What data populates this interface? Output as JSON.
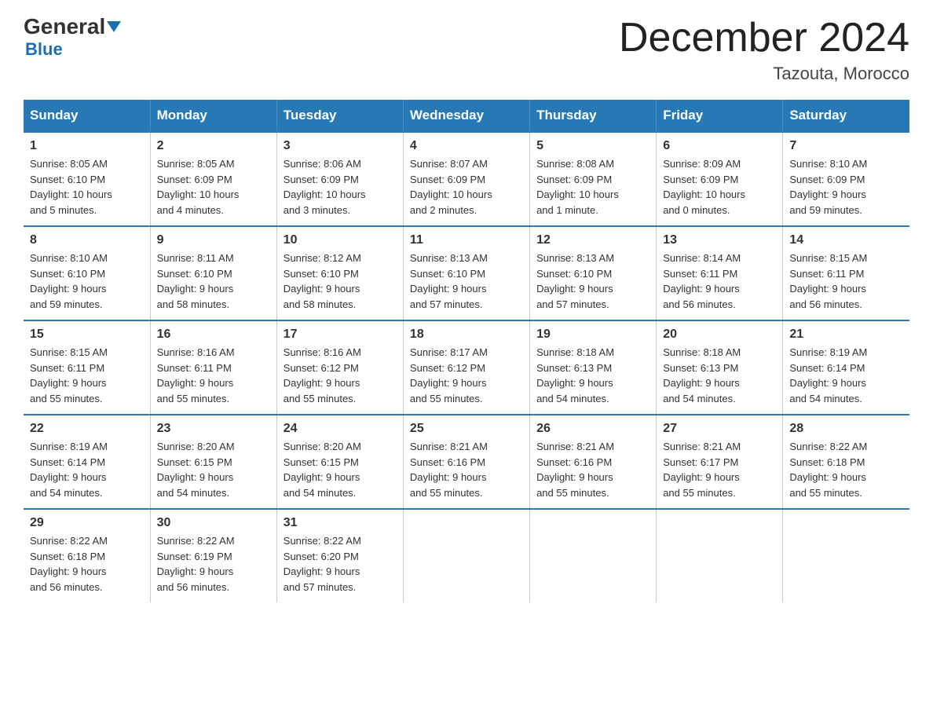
{
  "logo": {
    "general": "General",
    "blue": "Blue",
    "triangle": "▼"
  },
  "title": "December 2024",
  "location": "Tazouta, Morocco",
  "days_of_week": [
    "Sunday",
    "Monday",
    "Tuesday",
    "Wednesday",
    "Thursday",
    "Friday",
    "Saturday"
  ],
  "weeks": [
    [
      {
        "day": "1",
        "info": "Sunrise: 8:05 AM\nSunset: 6:10 PM\nDaylight: 10 hours\nand 5 minutes."
      },
      {
        "day": "2",
        "info": "Sunrise: 8:05 AM\nSunset: 6:09 PM\nDaylight: 10 hours\nand 4 minutes."
      },
      {
        "day": "3",
        "info": "Sunrise: 8:06 AM\nSunset: 6:09 PM\nDaylight: 10 hours\nand 3 minutes."
      },
      {
        "day": "4",
        "info": "Sunrise: 8:07 AM\nSunset: 6:09 PM\nDaylight: 10 hours\nand 2 minutes."
      },
      {
        "day": "5",
        "info": "Sunrise: 8:08 AM\nSunset: 6:09 PM\nDaylight: 10 hours\nand 1 minute."
      },
      {
        "day": "6",
        "info": "Sunrise: 8:09 AM\nSunset: 6:09 PM\nDaylight: 10 hours\nand 0 minutes."
      },
      {
        "day": "7",
        "info": "Sunrise: 8:10 AM\nSunset: 6:09 PM\nDaylight: 9 hours\nand 59 minutes."
      }
    ],
    [
      {
        "day": "8",
        "info": "Sunrise: 8:10 AM\nSunset: 6:10 PM\nDaylight: 9 hours\nand 59 minutes."
      },
      {
        "day": "9",
        "info": "Sunrise: 8:11 AM\nSunset: 6:10 PM\nDaylight: 9 hours\nand 58 minutes."
      },
      {
        "day": "10",
        "info": "Sunrise: 8:12 AM\nSunset: 6:10 PM\nDaylight: 9 hours\nand 58 minutes."
      },
      {
        "day": "11",
        "info": "Sunrise: 8:13 AM\nSunset: 6:10 PM\nDaylight: 9 hours\nand 57 minutes."
      },
      {
        "day": "12",
        "info": "Sunrise: 8:13 AM\nSunset: 6:10 PM\nDaylight: 9 hours\nand 57 minutes."
      },
      {
        "day": "13",
        "info": "Sunrise: 8:14 AM\nSunset: 6:11 PM\nDaylight: 9 hours\nand 56 minutes."
      },
      {
        "day": "14",
        "info": "Sunrise: 8:15 AM\nSunset: 6:11 PM\nDaylight: 9 hours\nand 56 minutes."
      }
    ],
    [
      {
        "day": "15",
        "info": "Sunrise: 8:15 AM\nSunset: 6:11 PM\nDaylight: 9 hours\nand 55 minutes."
      },
      {
        "day": "16",
        "info": "Sunrise: 8:16 AM\nSunset: 6:11 PM\nDaylight: 9 hours\nand 55 minutes."
      },
      {
        "day": "17",
        "info": "Sunrise: 8:16 AM\nSunset: 6:12 PM\nDaylight: 9 hours\nand 55 minutes."
      },
      {
        "day": "18",
        "info": "Sunrise: 8:17 AM\nSunset: 6:12 PM\nDaylight: 9 hours\nand 55 minutes."
      },
      {
        "day": "19",
        "info": "Sunrise: 8:18 AM\nSunset: 6:13 PM\nDaylight: 9 hours\nand 54 minutes."
      },
      {
        "day": "20",
        "info": "Sunrise: 8:18 AM\nSunset: 6:13 PM\nDaylight: 9 hours\nand 54 minutes."
      },
      {
        "day": "21",
        "info": "Sunrise: 8:19 AM\nSunset: 6:14 PM\nDaylight: 9 hours\nand 54 minutes."
      }
    ],
    [
      {
        "day": "22",
        "info": "Sunrise: 8:19 AM\nSunset: 6:14 PM\nDaylight: 9 hours\nand 54 minutes."
      },
      {
        "day": "23",
        "info": "Sunrise: 8:20 AM\nSunset: 6:15 PM\nDaylight: 9 hours\nand 54 minutes."
      },
      {
        "day": "24",
        "info": "Sunrise: 8:20 AM\nSunset: 6:15 PM\nDaylight: 9 hours\nand 54 minutes."
      },
      {
        "day": "25",
        "info": "Sunrise: 8:21 AM\nSunset: 6:16 PM\nDaylight: 9 hours\nand 55 minutes."
      },
      {
        "day": "26",
        "info": "Sunrise: 8:21 AM\nSunset: 6:16 PM\nDaylight: 9 hours\nand 55 minutes."
      },
      {
        "day": "27",
        "info": "Sunrise: 8:21 AM\nSunset: 6:17 PM\nDaylight: 9 hours\nand 55 minutes."
      },
      {
        "day": "28",
        "info": "Sunrise: 8:22 AM\nSunset: 6:18 PM\nDaylight: 9 hours\nand 55 minutes."
      }
    ],
    [
      {
        "day": "29",
        "info": "Sunrise: 8:22 AM\nSunset: 6:18 PM\nDaylight: 9 hours\nand 56 minutes."
      },
      {
        "day": "30",
        "info": "Sunrise: 8:22 AM\nSunset: 6:19 PM\nDaylight: 9 hours\nand 56 minutes."
      },
      {
        "day": "31",
        "info": "Sunrise: 8:22 AM\nSunset: 6:20 PM\nDaylight: 9 hours\nand 57 minutes."
      },
      {
        "day": "",
        "info": ""
      },
      {
        "day": "",
        "info": ""
      },
      {
        "day": "",
        "info": ""
      },
      {
        "day": "",
        "info": ""
      }
    ]
  ]
}
